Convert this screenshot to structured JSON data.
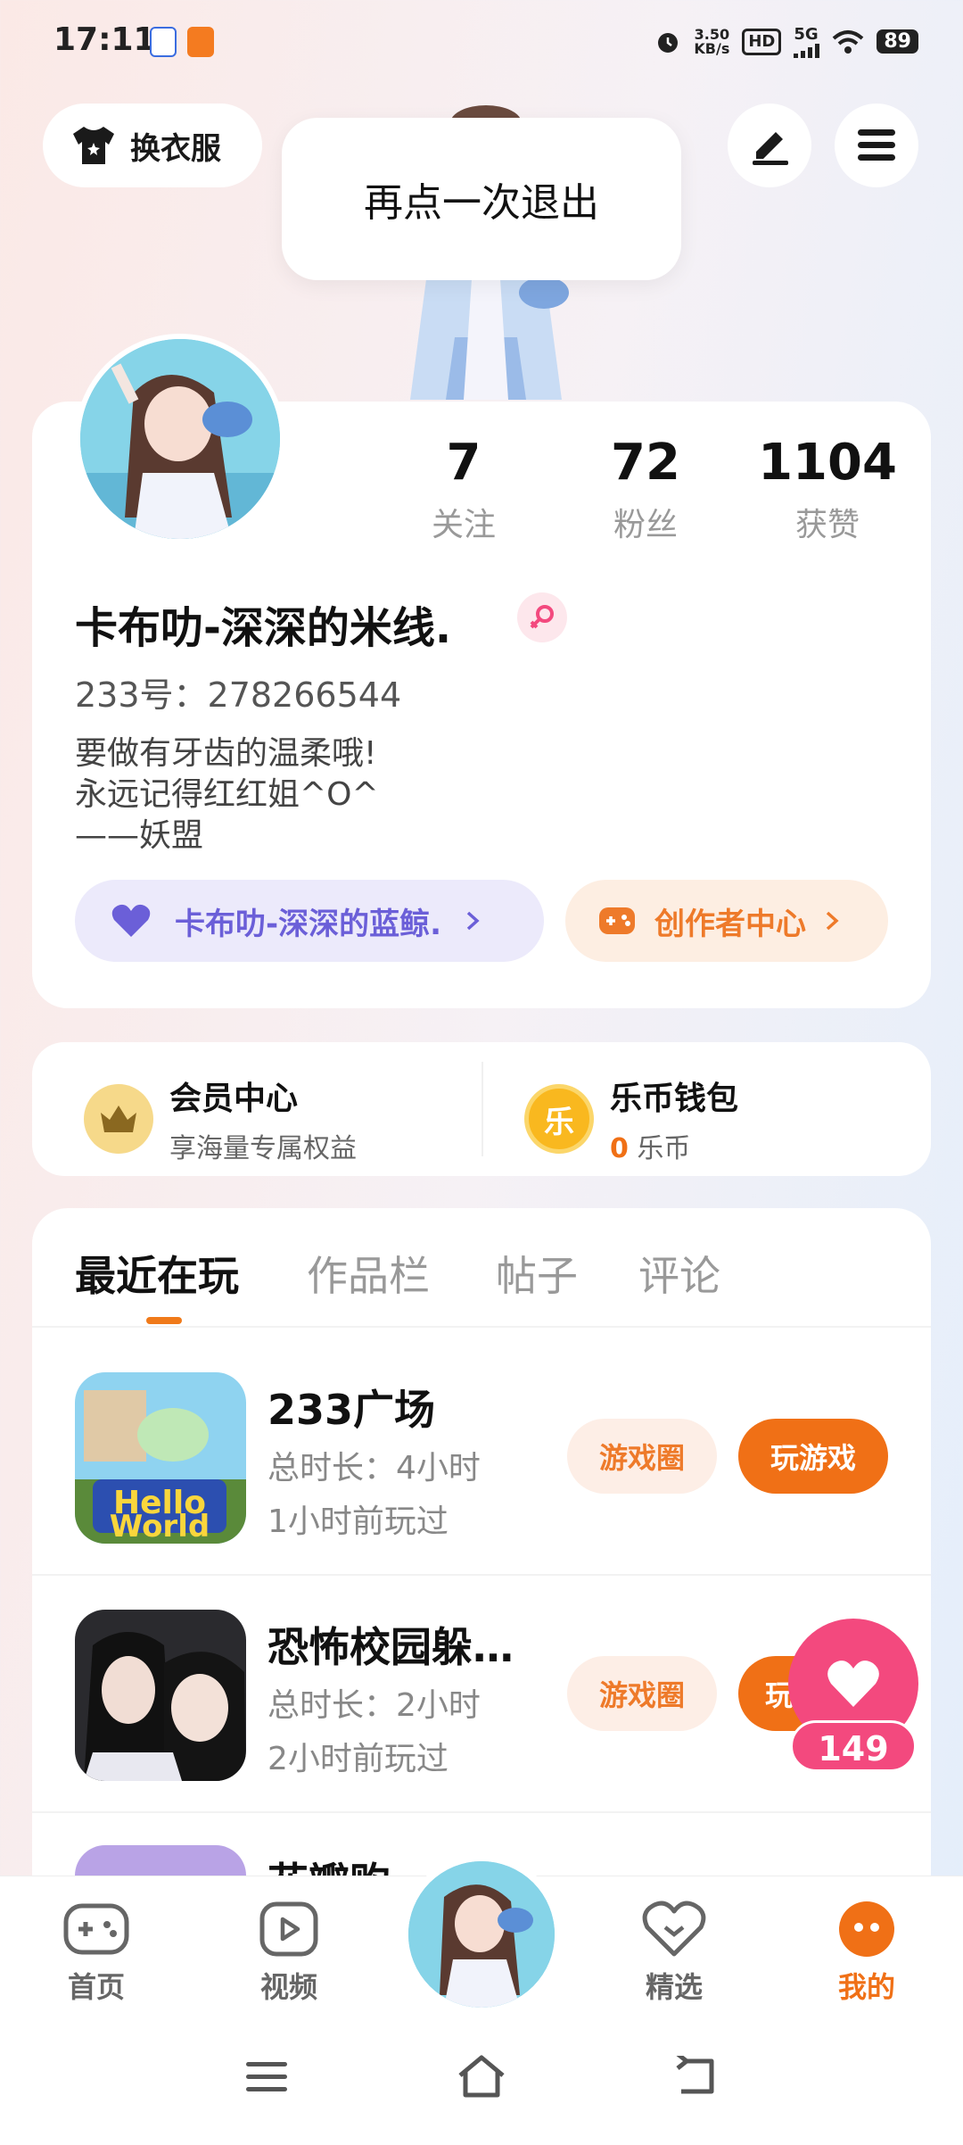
{
  "status_bar": {
    "time": "17:11",
    "net_speed_value": "3.50",
    "net_speed_unit": "KB/s",
    "hd": "HD",
    "network": "5G",
    "battery": "89"
  },
  "header": {
    "wardrobe_label": "换衣服",
    "toast": "再点一次退出"
  },
  "profile": {
    "stats": [
      {
        "value": "7",
        "label": "关注"
      },
      {
        "value": "72",
        "label": "粉丝"
      },
      {
        "value": "1104",
        "label": "获赞"
      }
    ],
    "username": "卡布叻-深深的米线.",
    "uid": "233号：278266544",
    "bio": "要做有牙齿的温柔哦!\n永远记得红红姐^O^\n——妖盟",
    "group_label": "卡布叻-深深的蓝鲸.",
    "creator_label": "创作者中心"
  },
  "member": {
    "vip_title": "会员中心",
    "vip_sub": "享海量专属权益",
    "wallet_title": "乐币钱包",
    "wallet_amount": "0",
    "wallet_unit": "乐币",
    "coin_glyph": "乐"
  },
  "tabs": [
    "最近在玩",
    "作品栏",
    "帖子",
    "评论"
  ],
  "games": [
    {
      "name": "233广场",
      "duration": "总时长：4小时",
      "last_played": "1小时前玩过",
      "circle_label": "游戏圈",
      "play_label": "玩游戏"
    },
    {
      "name": "恐怖校园躲…",
      "duration": "总时长：2小时",
      "last_played": "2小时前玩过",
      "circle_label": "游戏圈",
      "play_label": "玩"
    },
    {
      "name": "花瓣购…"
    }
  ],
  "like_count": "149",
  "bottom_nav": {
    "items": [
      {
        "label": "首页"
      },
      {
        "label": "视频"
      },
      {
        "label": "精选"
      },
      {
        "label": "我的"
      }
    ]
  },
  "colors": {
    "accent": "#f07016",
    "like": "#f3497e",
    "group_pill": "#6b5fd8"
  },
  "icons": [
    "wardrobe-icon",
    "edit-icon",
    "menu-icon",
    "gender-female-icon",
    "heart-icon",
    "chevron-right-icon",
    "gamepad-icon",
    "crown-icon",
    "coin-icon",
    "home-gamepad-icon",
    "video-icon",
    "featured-icon",
    "profile-icon"
  ]
}
